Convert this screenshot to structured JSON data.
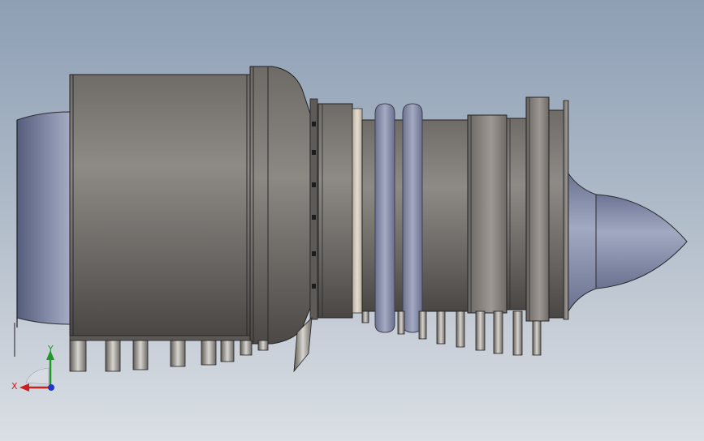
{
  "viewport": {
    "colors": {
      "background_top": "#8e9fb4",
      "background_bottom": "#dadfe5",
      "housing": "#7f7b77",
      "housing_dark": "#4f4b48",
      "spinner": "#8c94b0",
      "tubes": "#8d93ad",
      "accent_band": "#d8d0c2",
      "axis_x": "#cc1f1f",
      "axis_y": "#1f9a2a",
      "axis_z": "#2036c8"
    }
  },
  "triad": {
    "x_label": "X",
    "y_label": "Y",
    "icon": "coordinate-triad-icon"
  }
}
